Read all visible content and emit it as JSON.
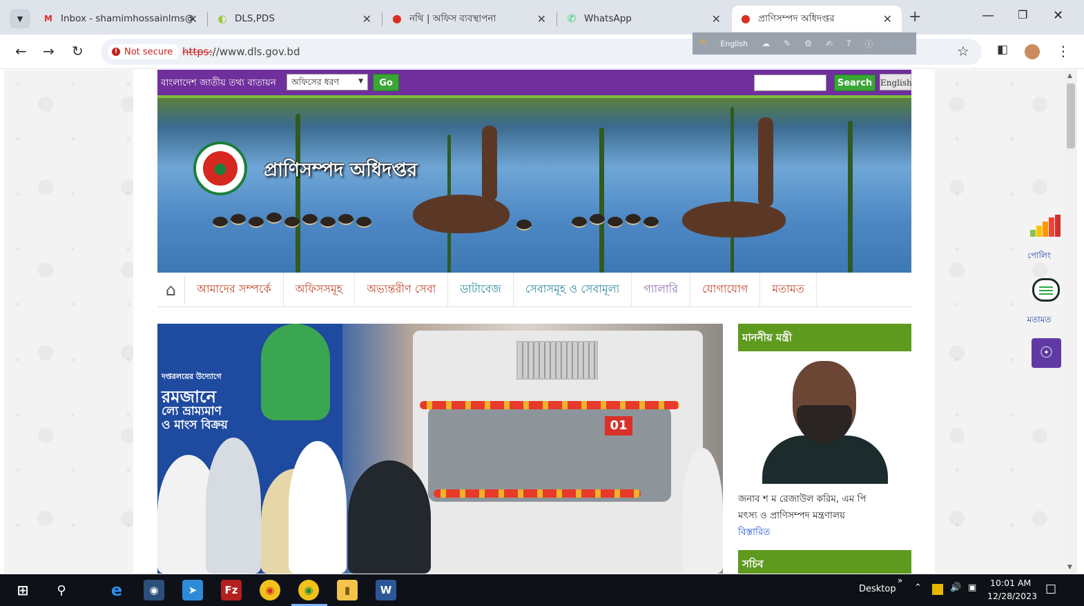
{
  "browser": {
    "tabs": [
      {
        "title": "Inbox - shamimhossainlms@",
        "favicon": "gmail-icon",
        "color": "#d93025"
      },
      {
        "title": "DLS,PDS",
        "favicon": "loading-icon",
        "color": "#9acd32"
      },
      {
        "title": "নথি | অফিস ব্যবস্থাপনা",
        "favicon": "nothi-icon",
        "color": "#d93025"
      },
      {
        "title": "WhatsApp",
        "favicon": "whatsapp-icon",
        "color": "#25d366"
      },
      {
        "title": "প্রাণিসম্পদ অধিদপ্তর",
        "favicon": "dls-icon",
        "color": "#d93025",
        "active": true
      }
    ],
    "new_tab": "+",
    "security_label": "Not secure",
    "url_scheme": "https:",
    "url_rest": "//www.dls.gov.bd",
    "extension_lang": "English"
  },
  "site": {
    "portal_title": "বাংলাদেশ জাতীয় তথ্য বাতায়ন",
    "office_select": "অফিসের ধরণ",
    "go_label": "Go",
    "search_label": "Search",
    "english_label": "English",
    "site_name": "প্রাণিসম্পদ অধিদপ্তর",
    "nav": [
      {
        "label": "আমাদের সম্পর্কে",
        "tone": "red"
      },
      {
        "label": "অফিসসমূহ",
        "tone": "red"
      },
      {
        "label": "অভ্যন্তরীণ সেবা",
        "tone": "red"
      },
      {
        "label": "ডাটাবেজ",
        "tone": "teal"
      },
      {
        "label": "সেবাসমূহ ও সেবামূল্য",
        "tone": "teal"
      },
      {
        "label": "গ্যালারি",
        "tone": "purple"
      },
      {
        "label": "যোগাযোগ",
        "tone": "red"
      },
      {
        "label": "মতামত",
        "tone": "red"
      }
    ],
    "hero": {
      "board_lines": [
        "দপ্তরলয়ের উদ্যোগে",
        "রমজানে",
        "ল্যে ভ্রাম্যমাণ",
        "ও মাংস বিক্রয়"
      ],
      "plate": "01"
    },
    "sidebar": {
      "minister_heading": "মাননীয় মন্ত্রী",
      "minister_name": "জনাব শ ম রেজাউল করিম, এম পি",
      "minister_ministry": "মৎস্য ও প্রাণিসম্পদ মন্ত্রণালয়",
      "more_link": "বিস্তারিত",
      "secretary_heading": "সচিব"
    },
    "floating": {
      "poll_label": "পোলিং",
      "feedback_label": "মতামত"
    }
  },
  "taskbar": {
    "desktop_label": "Desktop",
    "time": "10:01 AM",
    "date": "12/28/2023"
  },
  "colors": {
    "topbar": "#6f2f9c",
    "green_button": "#3aa635",
    "side_head": "#5e9a1e",
    "nav_red": "#c2472b"
  }
}
